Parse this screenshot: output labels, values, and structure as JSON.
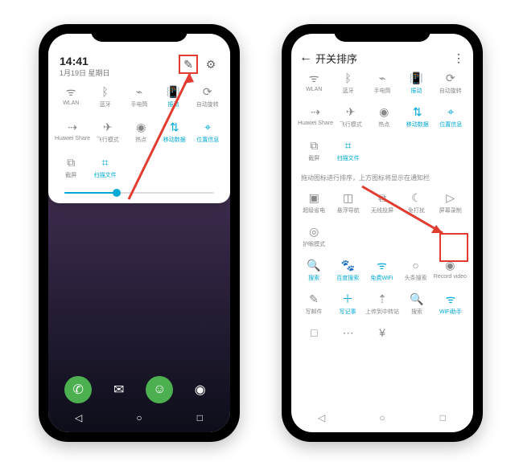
{
  "colors": {
    "accent": "#00a9d6",
    "highlight": "#e23b2f"
  },
  "left": {
    "time": "14:41",
    "date": "1月19日 星期日",
    "edit_label": "✎",
    "settings_label": "⚙",
    "tiles_row1": [
      {
        "icon": "wifi",
        "glyph": "ᯤ",
        "label": "WLAN",
        "active": false
      },
      {
        "icon": "bluetooth",
        "glyph": "ᛒ",
        "label": "蓝牙",
        "active": false
      },
      {
        "icon": "flashlight",
        "glyph": "⌁",
        "label": "手电筒",
        "active": false
      },
      {
        "icon": "vibrate",
        "glyph": "📳",
        "label": "振动",
        "active": true
      },
      {
        "icon": "rotate",
        "glyph": "⟳",
        "label": "自动旋转",
        "active": false
      }
    ],
    "tiles_row2": [
      {
        "icon": "share",
        "glyph": "⇢",
        "label": "Huawei Share",
        "active": false
      },
      {
        "icon": "airplane",
        "glyph": "✈",
        "label": "飞行模式",
        "active": false
      },
      {
        "icon": "hotspot",
        "glyph": "◉",
        "label": "热点",
        "active": false
      },
      {
        "icon": "data",
        "glyph": "⇅",
        "label": "移动数据",
        "active": true
      },
      {
        "icon": "location",
        "glyph": "⌖",
        "label": "位置信息",
        "active": true
      }
    ],
    "tiles_row3": [
      {
        "icon": "screenshot",
        "glyph": "⧉",
        "label": "截屏",
        "active": false
      },
      {
        "icon": "scan",
        "glyph": "⌗",
        "label": "扫描文件",
        "active": true
      }
    ],
    "brightness_percent": 35,
    "dock": [
      {
        "name": "phone",
        "glyph": "✆"
      },
      {
        "name": "messages",
        "glyph": "✉"
      },
      {
        "name": "contacts",
        "glyph": "☺"
      },
      {
        "name": "camera",
        "glyph": "◉"
      }
    ],
    "navbar": [
      {
        "name": "back",
        "glyph": "◁"
      },
      {
        "name": "home",
        "glyph": "○"
      },
      {
        "name": "recent",
        "glyph": "□"
      }
    ]
  },
  "right": {
    "title": "开关排序",
    "more": "⋮",
    "tiles_top_row1": [
      {
        "glyph": "ᯤ",
        "label": "WLAN",
        "active": false
      },
      {
        "glyph": "ᛒ",
        "label": "蓝牙",
        "active": false
      },
      {
        "glyph": "⌁",
        "label": "手电筒",
        "active": false
      },
      {
        "glyph": "📳",
        "label": "振动",
        "active": true
      },
      {
        "glyph": "⟳",
        "label": "自动旋转",
        "active": false
      }
    ],
    "tiles_top_row2": [
      {
        "glyph": "⇢",
        "label": "Huawei Share",
        "active": false
      },
      {
        "glyph": "✈",
        "label": "飞行模式",
        "active": false
      },
      {
        "glyph": "◉",
        "label": "热点",
        "active": false
      },
      {
        "glyph": "⇅",
        "label": "移动数据",
        "active": true
      },
      {
        "glyph": "⌖",
        "label": "位置信息",
        "active": true
      }
    ],
    "tiles_top_row3": [
      {
        "glyph": "⧉",
        "label": "截屏",
        "active": false
      },
      {
        "glyph": "⌗",
        "label": "扫描文件",
        "active": true
      }
    ],
    "hint": "拖动图标进行排序，上方图标将显示在通知栏",
    "tiles_mid_row1": [
      {
        "glyph": "▣",
        "label": "超级省电",
        "active": false
      },
      {
        "glyph": "◫",
        "label": "悬浮导航",
        "active": false
      },
      {
        "glyph": "⧉",
        "label": "无线投屏",
        "active": false
      },
      {
        "glyph": "☾",
        "label": "免打扰",
        "active": false
      },
      {
        "glyph": "▷",
        "label": "屏幕录制",
        "active": false,
        "boxed": true
      }
    ],
    "tiles_mid_row2": [
      {
        "glyph": "◎",
        "label": "护眼模式",
        "active": false
      }
    ],
    "tiles_bottom_row1": [
      {
        "glyph": "🔍",
        "label": "搜索",
        "active": true
      },
      {
        "glyph": "🐾",
        "label": "百度搜索",
        "active": true
      },
      {
        "glyph": "ᯤ",
        "label": "免费WiFi",
        "active": true
      },
      {
        "glyph": "○",
        "label": "头条搜索",
        "active": false
      },
      {
        "glyph": "◉",
        "label": "Record video",
        "active": false
      }
    ],
    "tiles_bottom_row2": [
      {
        "glyph": "✎",
        "label": "写邮件",
        "active": false
      },
      {
        "glyph": "＋",
        "label": "写记事",
        "active": true
      },
      {
        "glyph": "⇡",
        "label": "上传到中转站",
        "active": false
      },
      {
        "glyph": "🔍",
        "label": "搜索",
        "active": false
      },
      {
        "glyph": "ᯤ",
        "label": "WiFi助手",
        "active": true
      }
    ],
    "tiles_bottom_row3": [
      {
        "glyph": "□",
        "label": "",
        "active": false
      },
      {
        "glyph": "⋯",
        "label": "",
        "active": false
      },
      {
        "glyph": "¥",
        "label": "",
        "active": false
      }
    ],
    "navbar": [
      {
        "name": "back",
        "glyph": "◁"
      },
      {
        "name": "home",
        "glyph": "○"
      },
      {
        "name": "recent",
        "glyph": "□"
      }
    ]
  }
}
